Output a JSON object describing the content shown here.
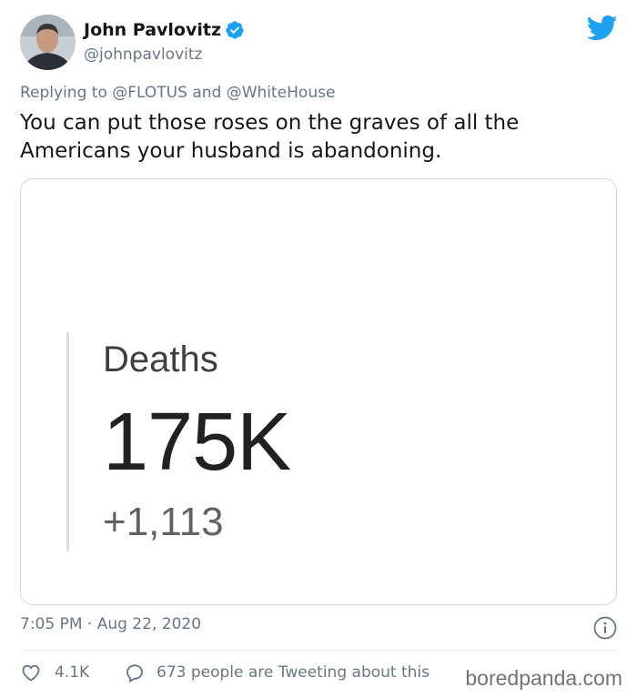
{
  "author": {
    "name": "John Pavlovitz",
    "handle": "@johnpavlovitz"
  },
  "reply": {
    "prefix": "Replying to",
    "mention_1": "@FLOTUS",
    "conjunction": "and",
    "mention_2": "@WhiteHouse"
  },
  "tweet": {
    "text": "You can put those roses on the graves of all the Americans your husband is abandoning."
  },
  "media": {
    "label": "Deaths",
    "value": "175K",
    "delta": "+1,113"
  },
  "meta": {
    "timestamp": "7:05 PM · Aug 22, 2020"
  },
  "actions": {
    "likes": "4.1K",
    "conversation": "673 people are Tweeting about this"
  },
  "watermark": "boredpanda.com",
  "colors": {
    "twitter_blue": "#1da1f2",
    "muted": "#657786",
    "text": "#14171a"
  },
  "icons": [
    "verified-badge-icon",
    "twitter-bird-icon",
    "info-icon",
    "heart-icon",
    "comment-icon"
  ]
}
